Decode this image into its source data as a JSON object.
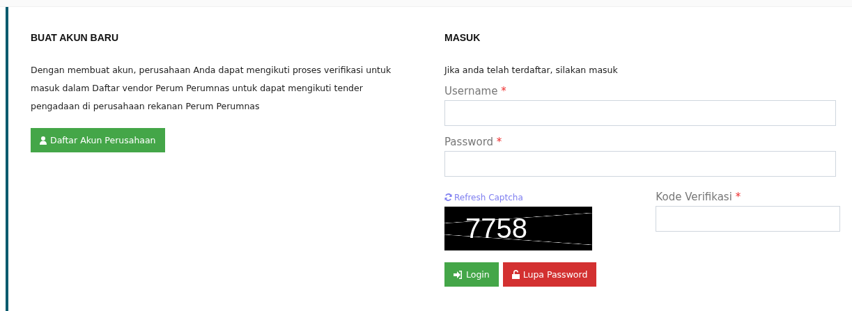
{
  "register": {
    "title": "BUAT AKUN BARU",
    "description": "Dengan membuat akun, perusahaan Anda dapat mengikuti proses verifikasi untuk masuk dalam Daftar vendor Perum Perumnas untuk dapat mengikuti tender pengadaan di perusahaan rekanan Perum Perumnas",
    "button": "Daftar Akun Perusahaan"
  },
  "login": {
    "title": "MASUK",
    "description": "Jika anda telah terdaftar, silakan masuk",
    "fields": [
      {
        "label": "Username",
        "required_mark": "*"
      },
      {
        "label": "Password",
        "required_mark": "*"
      }
    ],
    "captcha": {
      "refresh_link": "Refresh Captcha",
      "code": "7758"
    },
    "verification": {
      "label": "Kode Verifikasi",
      "required_mark": "*"
    },
    "buttons": [
      {
        "kind": "primary",
        "label": "Login"
      },
      {
        "kind": "danger",
        "label": "Lupa Password"
      }
    ]
  }
}
